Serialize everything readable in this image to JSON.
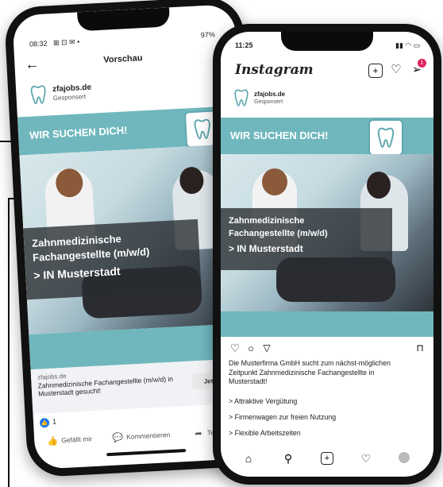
{
  "facebook": {
    "status_time": "08:32",
    "status_icons_left": "⊞ ⊡ ✉ •",
    "status_right": "97%",
    "nav_title": "Vorschau",
    "page_name": "zfajobs.de",
    "sponsored": "Gesponsert",
    "banner_text": "WIR SUCHEN DICH!",
    "overlay_line1": "Zahnmedizinische",
    "overlay_line2": "Fachangestellte (m/w/d)",
    "overlay_line3": "> IN Musterstadt",
    "domain": "zfajobs.de",
    "cta_text": "Zahnmedizinische Fachangestellte (m/w/d) in Musterstadt gesucht!",
    "cta_button": "Jetzt bewer",
    "reactions_count": "1",
    "like_label": "Gefällt mir",
    "comment_label": "Kommentieren",
    "share_label": "Teil"
  },
  "instagram": {
    "status_time": "11:25",
    "app_title": "Instagram",
    "notification_badge": "1",
    "page_name": "zfajobs.de",
    "sponsored": "Gesponsert",
    "banner_text": "WIR SUCHEN DICH!",
    "overlay_line1": "Zahnmedizinische",
    "overlay_line2": "Fachangestellte (m/w/d)",
    "overlay_line3": "> IN Musterstadt",
    "caption": "Die Musterfirma GmbH sucht zum nächst-möglichen Zeitpunkt Zahnmedizinische Fachangestellte in Musterstadt!",
    "bullet1": "> Attraktive Vergütung",
    "bullet2": "> Firmenwagen zur freien Nutzung",
    "bullet3": "> Flexible Arbeitszeiten"
  },
  "colors": {
    "teal": "#6fb7bd",
    "overlay": "#2c3034",
    "badge": "#e0245e"
  }
}
